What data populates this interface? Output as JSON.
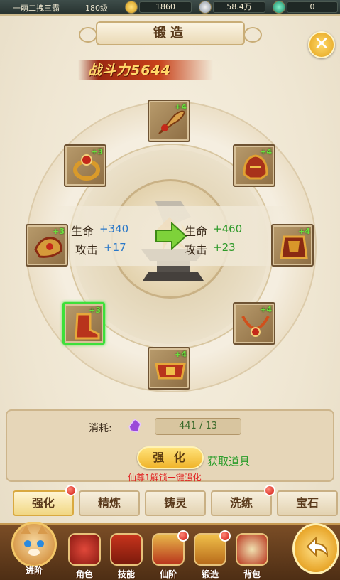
{
  "status_bar": {
    "player_name": "一萌二拽三霸",
    "level": "180级",
    "gold": "1860",
    "silver": "58.4万",
    "jade": "0"
  },
  "panel": {
    "title": "锻造",
    "combat_power": "战斗力5644"
  },
  "stats": {
    "current": [
      {
        "label": "生命",
        "value": "+340"
      },
      {
        "label": "攻击",
        "value": "+17"
      }
    ],
    "next": [
      {
        "label": "生命",
        "value": "+460"
      },
      {
        "label": "攻击",
        "value": "+23"
      }
    ]
  },
  "equipment": [
    {
      "name": "weapon",
      "level": "+4",
      "icon": "weapon-icon"
    },
    {
      "name": "ring",
      "level": "+3",
      "icon": "ring-icon"
    },
    {
      "name": "helmet",
      "level": "+4",
      "icon": "helmet-icon"
    },
    {
      "name": "shoulder",
      "level": "+3",
      "icon": "shoulder-icon"
    },
    {
      "name": "armor",
      "level": "+4",
      "icon": "armor-icon"
    },
    {
      "name": "boots",
      "level": "+3",
      "icon": "boots-icon"
    },
    {
      "name": "necklace",
      "level": "+4",
      "icon": "necklace-icon"
    },
    {
      "name": "belt",
      "level": "+4",
      "icon": "belt-icon"
    }
  ],
  "cost": {
    "label": "消耗:",
    "value": "441 / 13"
  },
  "actions": {
    "enhance": "强 化",
    "get_items": "获取道具",
    "unlock_tip": "仙尊1解锁一键强化"
  },
  "tabs": [
    {
      "label": "强化",
      "active": true,
      "badge": true
    },
    {
      "label": "精炼",
      "active": false,
      "badge": false
    },
    {
      "label": "铸灵",
      "active": false,
      "badge": false
    },
    {
      "label": "洗练",
      "active": false,
      "badge": true
    },
    {
      "label": "宝石",
      "active": false,
      "badge": false
    }
  ],
  "bottom_nav": [
    {
      "label": "进阶",
      "icon": "cat-avatar-icon"
    },
    {
      "label": "角色",
      "icon": "character-icon"
    },
    {
      "label": "技能",
      "icon": "skill-book-icon"
    },
    {
      "label": "仙阶",
      "icon": "immortal-rank-icon"
    },
    {
      "label": "锻造",
      "icon": "forge-icon"
    },
    {
      "label": "背包",
      "icon": "backpack-icon"
    }
  ],
  "colors": {
    "accent_gold": "#f0b52b",
    "stat_blue": "#2a78c8",
    "stat_green": "#2f9a2a",
    "warning_red": "#e01d1d",
    "selected_green": "#3de03a"
  }
}
